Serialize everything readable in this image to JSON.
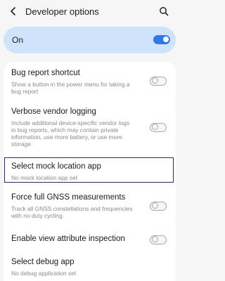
{
  "header": {
    "title": "Developer options",
    "back_icon": "back-arrow-icon",
    "search_icon": "search-icon"
  },
  "master": {
    "label": "On",
    "state": "on"
  },
  "items": [
    {
      "title": "Bug report shortcut",
      "subtitle_lines": [
        "Show a button in the power menu for taking a",
        "bug report"
      ],
      "toggle": "off"
    },
    {
      "title": "Verbose vendor logging",
      "subtitle_lines": [
        "Include additional device-specific vendor logs",
        "in bug reports, which may contain private",
        "information, use more battery, or use more",
        "storage."
      ],
      "toggle": "off"
    },
    {
      "title": "Select mock location app",
      "subtitle_lines": [
        "No mock location app set"
      ],
      "toggle": null
    },
    {
      "title": "Force full GNSS measurements",
      "subtitle_lines": [
        "Track all GNSS constellations and frequencies",
        "with no duty cycling."
      ],
      "toggle": "off"
    },
    {
      "title": "Enable view attribute inspection",
      "subtitle_lines": [],
      "toggle": "off"
    },
    {
      "title": "Select debug app",
      "subtitle_lines": [
        "No debug application set"
      ],
      "toggle": null
    }
  ],
  "colors": {
    "accent": "#2f7be5",
    "master_bg": "#cfe4fb",
    "selection_border": "#1f2d6b"
  }
}
